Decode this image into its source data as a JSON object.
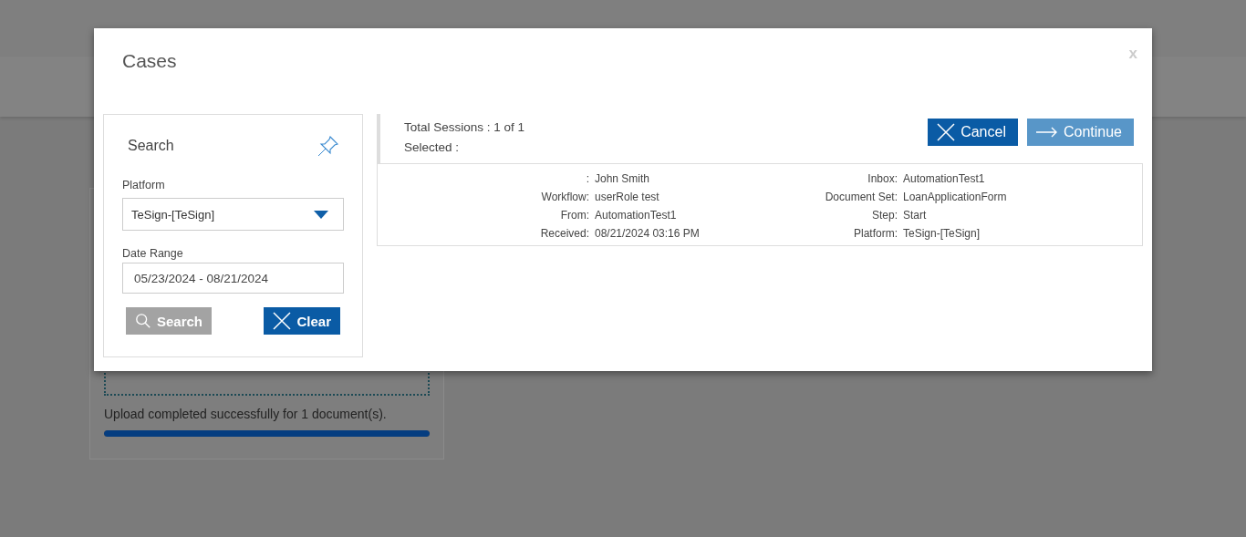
{
  "background": {
    "upload_message": "Upload completed successfully for 1 document(s).",
    "upload_progress": {
      "level": 1
    }
  },
  "window": {
    "title": "Cases",
    "close": "x"
  },
  "search_panel": {
    "title": "Search",
    "platform": {
      "label": "Platform",
      "value": "TeSign-[TeSign]"
    },
    "date_range": {
      "label": "Date Range",
      "value": "05/23/2024 - 08/21/2024"
    },
    "buttons": [
      {
        "label": "Search",
        "kind": "search",
        "disabled": true
      },
      {
        "label": "Clear",
        "kind": "clear",
        "disabled": false
      }
    ]
  },
  "sessions": {
    "total": "Total Sessions : 1 of 1",
    "selected": "Selected :",
    "buttons": [
      {
        "label": "Cancel",
        "kind": "cancel",
        "disabled": false
      },
      {
        "label": "Continue",
        "kind": "continue",
        "disabled": true
      }
    ]
  },
  "case": {
    "columns": [
      [
        {
          "label": ":",
          "value": "John Smith"
        },
        {
          "label": "Workflow:",
          "value": "userRole test"
        },
        {
          "label": "From:",
          "value": "AutomationTest1"
        },
        {
          "label": "Received:",
          "value": "08/21/2024 03:16 PM"
        }
      ],
      [
        {
          "label": "Inbox:",
          "value": "AutomationTest1"
        },
        {
          "label": "Document Set:",
          "value": "LoanApplicationForm"
        },
        {
          "label": "Step:",
          "value": "Start"
        },
        {
          "label": "Platform:",
          "value": "TeSign-[TeSign]"
        }
      ]
    ]
  }
}
